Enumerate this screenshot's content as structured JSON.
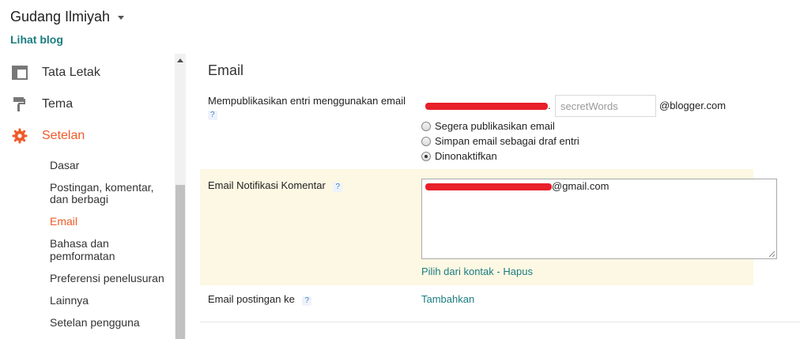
{
  "header": {
    "blog_name": "Gudang Ilmiyah",
    "view_blog_link": "Lihat blog"
  },
  "sidebar": {
    "items": [
      {
        "label": "Tata Letak",
        "icon": "layout-icon"
      },
      {
        "label": "Tema",
        "icon": "paint-roller-icon"
      },
      {
        "label": "Setelan",
        "icon": "gear-icon",
        "active": true
      }
    ],
    "subitems": [
      "Dasar",
      "Postingan, komentar,",
      "dan berbagi",
      "Email",
      "Bahasa dan",
      "pemformatan",
      "Preferensi penelusuran",
      "Lainnya",
      "Setelan pengguna"
    ],
    "active_subitem": "Email"
  },
  "main": {
    "title": "Email",
    "publish_via_email": {
      "label": "Mempublikasikan entri menggunakan email",
      "help": "?",
      "dot": ".",
      "secret_placeholder": "secretWords",
      "domain_suffix": "@blogger.com",
      "options": [
        "Segera publikasikan email",
        "Simpan email sebagai draf entri",
        "Dinonaktifkan"
      ],
      "selected_option": "Dinonaktifkan"
    },
    "comment_notification": {
      "label": "Email Notifikasi Komentar",
      "help": "?",
      "value_suffix": "@gmail.com",
      "pick_contacts": "Pilih dari kontak",
      "separator": "-",
      "remove": "Hapus"
    },
    "post_email_to": {
      "label": "Email postingan ke",
      "help": "?",
      "add": "Tambahkan"
    }
  },
  "colors": {
    "accent": "#f05a28",
    "link": "#1a7c80",
    "highlight_row": "#fdf8e3",
    "redaction": "#e8202a"
  }
}
